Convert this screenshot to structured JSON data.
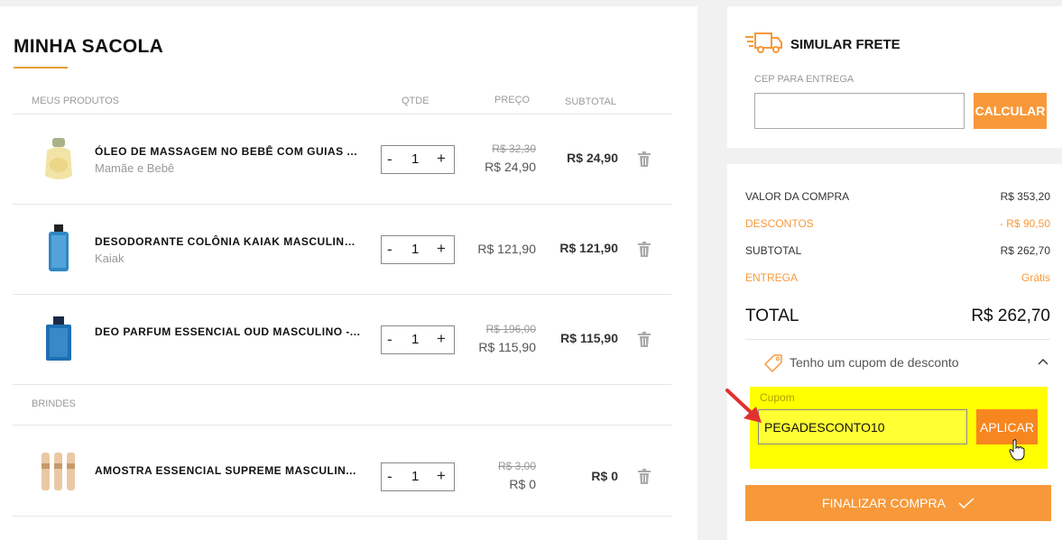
{
  "cart": {
    "title": "MINHA SACOLA",
    "headers": {
      "products": "MEUS PRODUTOS",
      "qty": "QTDE",
      "price": "PREÇO",
      "subtotal": "SUBTOTAL"
    },
    "items": [
      {
        "name": "ÓLEO DE MASSAGEM NO BEBÊ COM GUIAS ...",
        "brand": "Mamãe e Bebê",
        "qty": "1",
        "old_price": "R$ 32,30",
        "price": "R$ 24,90",
        "subtotal": "R$ 24,90"
      },
      {
        "name": "DESODORANTE COLÔNIA KAIAK MASCULINO...",
        "brand": "Kaiak",
        "qty": "1",
        "old_price": "",
        "price": "R$ 121,90",
        "subtotal": "R$ 121,90"
      },
      {
        "name": "DEO PARFUM ESSENCIAL OUD MASCULINO -...",
        "brand": "",
        "qty": "1",
        "old_price": "R$ 196,00",
        "price": "R$ 115,90",
        "subtotal": "R$ 115,90"
      }
    ],
    "gifts_label": "BRINDES",
    "gifts": [
      {
        "name": "AMOSTRA ESSENCIAL SUPREME MASCULIN...",
        "qty": "1",
        "old_price": "R$ 3,00",
        "price": "R$ 0",
        "subtotal": "R$ 0"
      }
    ],
    "minus": "-",
    "plus": "+"
  },
  "freight": {
    "title": "SIMULAR FRETE",
    "cep_label": "CEP PARA ENTREGA",
    "cep_value": "",
    "button": "CALCULAR"
  },
  "summary": {
    "rows": [
      {
        "label": "VALOR DA COMPRA",
        "value": "R$ 353,20"
      },
      {
        "label": "DESCONTOS",
        "value": "- R$ 90,50"
      },
      {
        "label": "SUBTOTAL",
        "value": "R$ 262,70"
      },
      {
        "label": "ENTREGA",
        "value": "Grátis"
      }
    ],
    "total_label": "TOTAL",
    "total_value": "R$ 262,70",
    "coupon_toggle": "Tenho um cupom de desconto",
    "coupon_label": "Cupom",
    "coupon_value": "PEGADESCONTO10",
    "apply": "APLICAR",
    "finalize": "FINALIZAR COMPRA"
  },
  "colors": {
    "accent": "#f7993a",
    "highlight": "#ffff00",
    "arrow": "#e03030"
  },
  "icons": [
    "truck-icon",
    "trash-icon",
    "tag-icon",
    "chevron-up-icon",
    "checkmark-icon",
    "hand-cursor-icon",
    "red-arrow-icon"
  ]
}
